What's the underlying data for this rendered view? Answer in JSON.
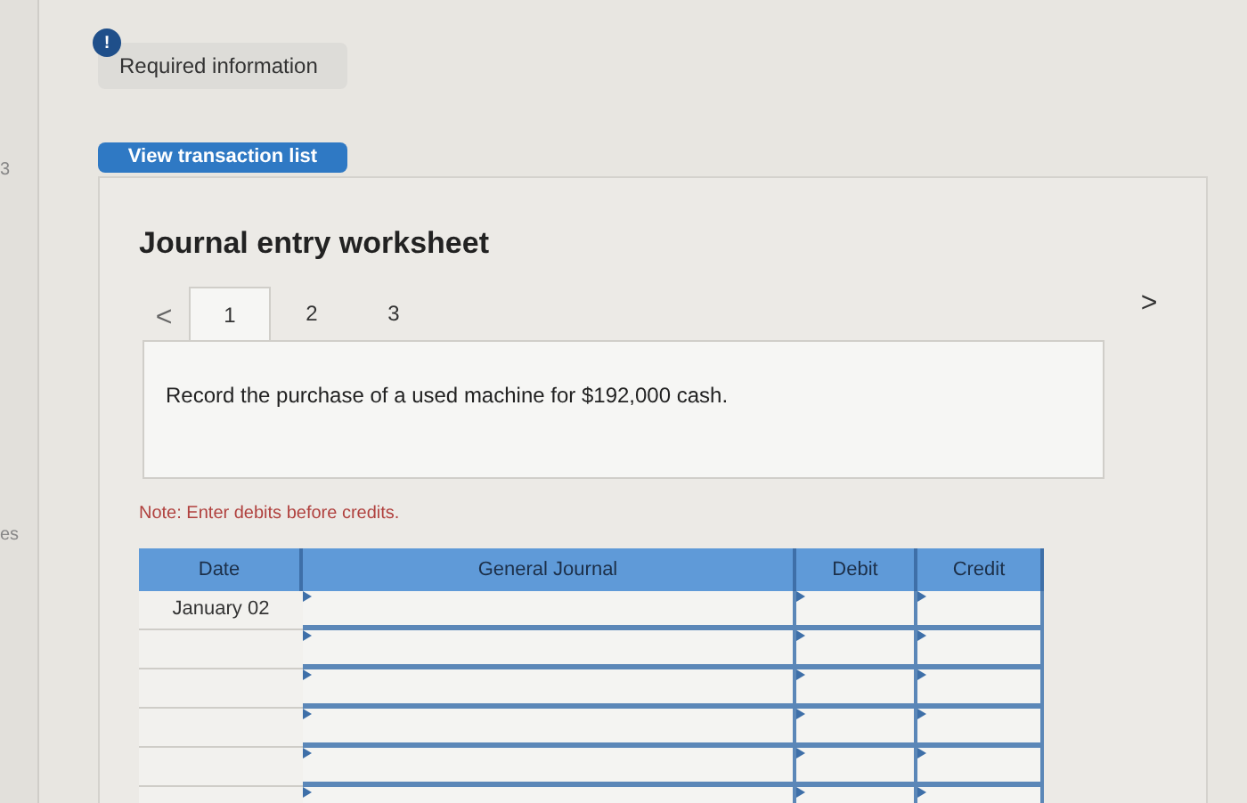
{
  "sidebar_fragments": [
    {
      "text": "3"
    },
    {
      "text": "es"
    }
  ],
  "alert": {
    "icon": "!",
    "label": "Required information"
  },
  "button": "View transaction list",
  "worksheet": {
    "title": "Journal entry worksheet",
    "prev": "<",
    "next": ">",
    "tabs": [
      {
        "label": "1",
        "selected": true
      },
      {
        "label": "2",
        "selected": false
      },
      {
        "label": "3",
        "selected": false
      }
    ],
    "description": "Record the purchase of a used machine for $192,000 cash.",
    "note": "Note: Enter debits before credits.",
    "table": {
      "columns": [
        "Date",
        "General Journal",
        "Debit",
        "Credit"
      ],
      "rows": [
        {
          "date": "January 02"
        },
        {},
        {},
        {},
        {},
        {}
      ]
    }
  }
}
